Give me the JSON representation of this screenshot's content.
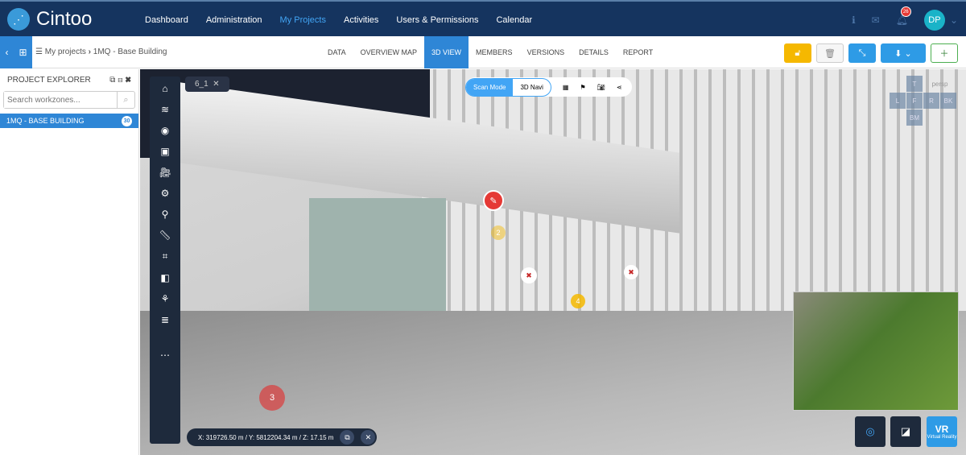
{
  "app": {
    "name": "Cintoo"
  },
  "nav": [
    "Dashboard",
    "Administration",
    "My Projects",
    "Activities",
    "Users & Permissions",
    "Calendar"
  ],
  "nav_active": "My Projects",
  "notifications": {
    "count": "26"
  },
  "user": {
    "initials": "DP"
  },
  "breadcrumb": {
    "root": "My projects",
    "separator": "›",
    "current": "1MQ - Base Building"
  },
  "tabs": [
    "DATA",
    "OVERVIEW MAP",
    "3D VIEW",
    "MEMBERS",
    "VERSIONS",
    "DETAILS",
    "REPORT"
  ],
  "tab_active": "3D VIEW",
  "colors": {
    "navy": "#15345f",
    "accent": "#2e86d6",
    "lock": "#f5b800",
    "marker_red": "#e53935"
  },
  "explorer": {
    "title": "PROJECT EXPLORER",
    "search_placeholder": "Search workzones...",
    "items": [
      {
        "label": "1MQ - BASE BUILDING",
        "count": "30"
      }
    ]
  },
  "viewer": {
    "scan_chip": "6_1",
    "mode": {
      "scan": "Scan Mode",
      "navi": "3D Navi"
    },
    "view_cube": {
      "top": "T",
      "persp": "persp",
      "left": "L",
      "front": "F",
      "right": "R",
      "back": "BK",
      "bottom": "BM"
    },
    "markers": [
      "2",
      "3",
      "4"
    ],
    "coords": "X: 319726.50 m / Y: 5812204.34 m / Z: 17.15 m",
    "vr": {
      "label1": "VR",
      "label2": "Virtual Reality"
    }
  }
}
